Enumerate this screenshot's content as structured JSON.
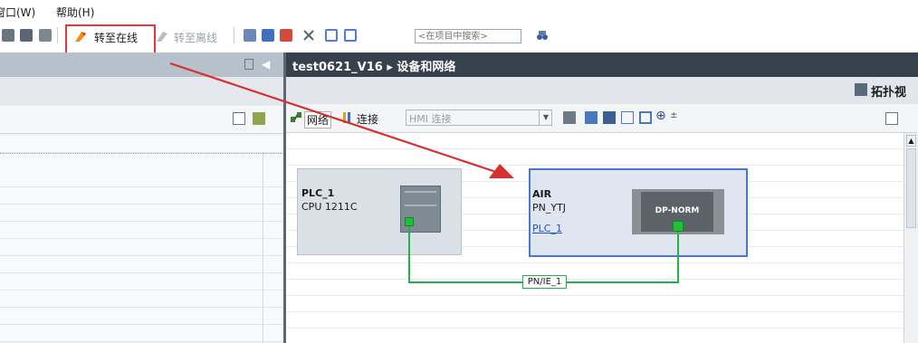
{
  "menu": {
    "window_label": "窗口(W)",
    "help_label": "帮助(H)"
  },
  "toolbar": {
    "go_online_label": "转至在线",
    "go_offline_label": "转至离线",
    "search_placeholder": "<在项目中搜索>"
  },
  "editor": {
    "breadcrumb": "test0621_V16 ▸ 设备和网络",
    "topology_view_label": "拓扑视"
  },
  "network_toolbar": {
    "network_button": "网络",
    "connection_button": "连接",
    "connection_type_value": "HMI 连接"
  },
  "devices": [
    {
      "name": "PLC_1",
      "type": "CPU 1211C"
    },
    {
      "name": "AIR",
      "type": "PN_YTJ",
      "controller_link": "PLC_1",
      "module_label": "DP-NORM"
    }
  ],
  "network": {
    "subnet_label": "PN/IE_1",
    "line_color": "#22b24a"
  },
  "annotation": {
    "highlight_color": "#e53935",
    "arrow_color": "#d63030"
  },
  "colors": {
    "accent": "#4c78c9",
    "title_bar": "#37414c"
  }
}
